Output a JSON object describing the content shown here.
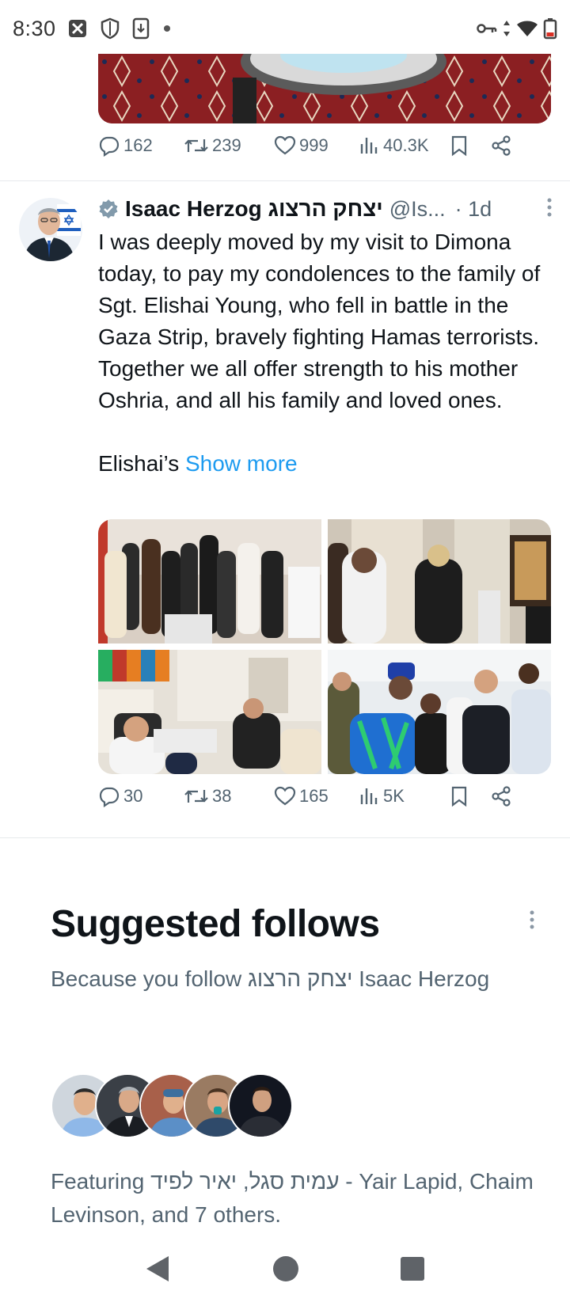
{
  "status_bar": {
    "time": "8:30",
    "left_icons": [
      "cast-icon",
      "shield-icon",
      "download-icon",
      "dot-icon"
    ],
    "right_icons": [
      "vpn-key-icon",
      "data-arrows-icon",
      "wifi-icon",
      "battery-icon"
    ]
  },
  "prev_tweet": {
    "actions": {
      "replies": "162",
      "retweets": "239",
      "likes": "999",
      "views": "40.3K"
    }
  },
  "tweet": {
    "author_name": "Isaac Herzog יצחק הרצוג",
    "handle": "@Is...",
    "time": "· 1d",
    "body": "I was deeply moved by my visit to Dimona today, to pay my condolences to the family of Sgt. Elishai Young, who fell in battle in the Gaza Strip, bravely fighting Hamas terrorists. Together we all offer strength to his mother Oshria, and all his family and loved ones.\n\nElishai’s ",
    "show_more": "Show more",
    "actions": {
      "replies": "30",
      "retweets": "38",
      "likes": "165",
      "views": "5K"
    }
  },
  "suggested_follows": {
    "title": "Suggested follows",
    "subtitle": "Because you follow יצחק הרצוג Isaac Herzog",
    "featuring": "Featuring עמית סגל, יאיר לפיד - Yair Lapid, Chaim Levinson, and 7 others."
  },
  "colors": {
    "accent": "#1d9bf0",
    "secondary_text": "#536471",
    "primary_text": "#0f1419"
  }
}
